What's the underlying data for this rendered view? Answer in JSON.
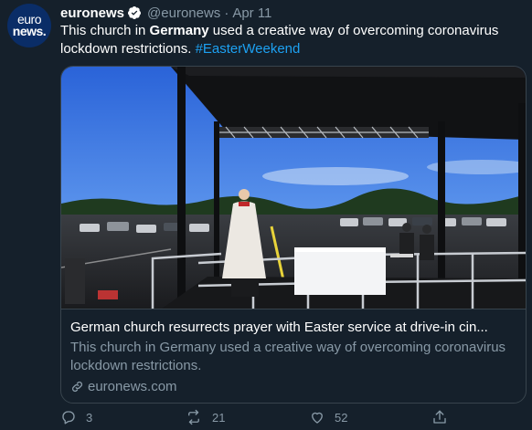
{
  "avatar": {
    "line1": "euro",
    "line2": "news."
  },
  "tweet": {
    "display_name": "euronews",
    "handle": "@euronews",
    "separator": "·",
    "date": "Apr 11",
    "text_part1": "This church in ",
    "text_bold": "Germany",
    "text_part2": " used a creative way of overcoming coronavirus lockdown restrictions. ",
    "hashtag": "#EasterWeekend"
  },
  "card": {
    "title": "German church resurrects prayer with Easter service at drive-in cin...",
    "description": "This church in Germany used a creative way of overcoming coronavirus lockdown restrictions.",
    "domain": "euronews.com"
  },
  "actions": {
    "reply_count": "3",
    "retweet_count": "21",
    "like_count": "52"
  },
  "colors": {
    "background": "#15202b",
    "accent": "#1da1f2",
    "secondary_text": "#8899a6",
    "border": "#38444d"
  }
}
